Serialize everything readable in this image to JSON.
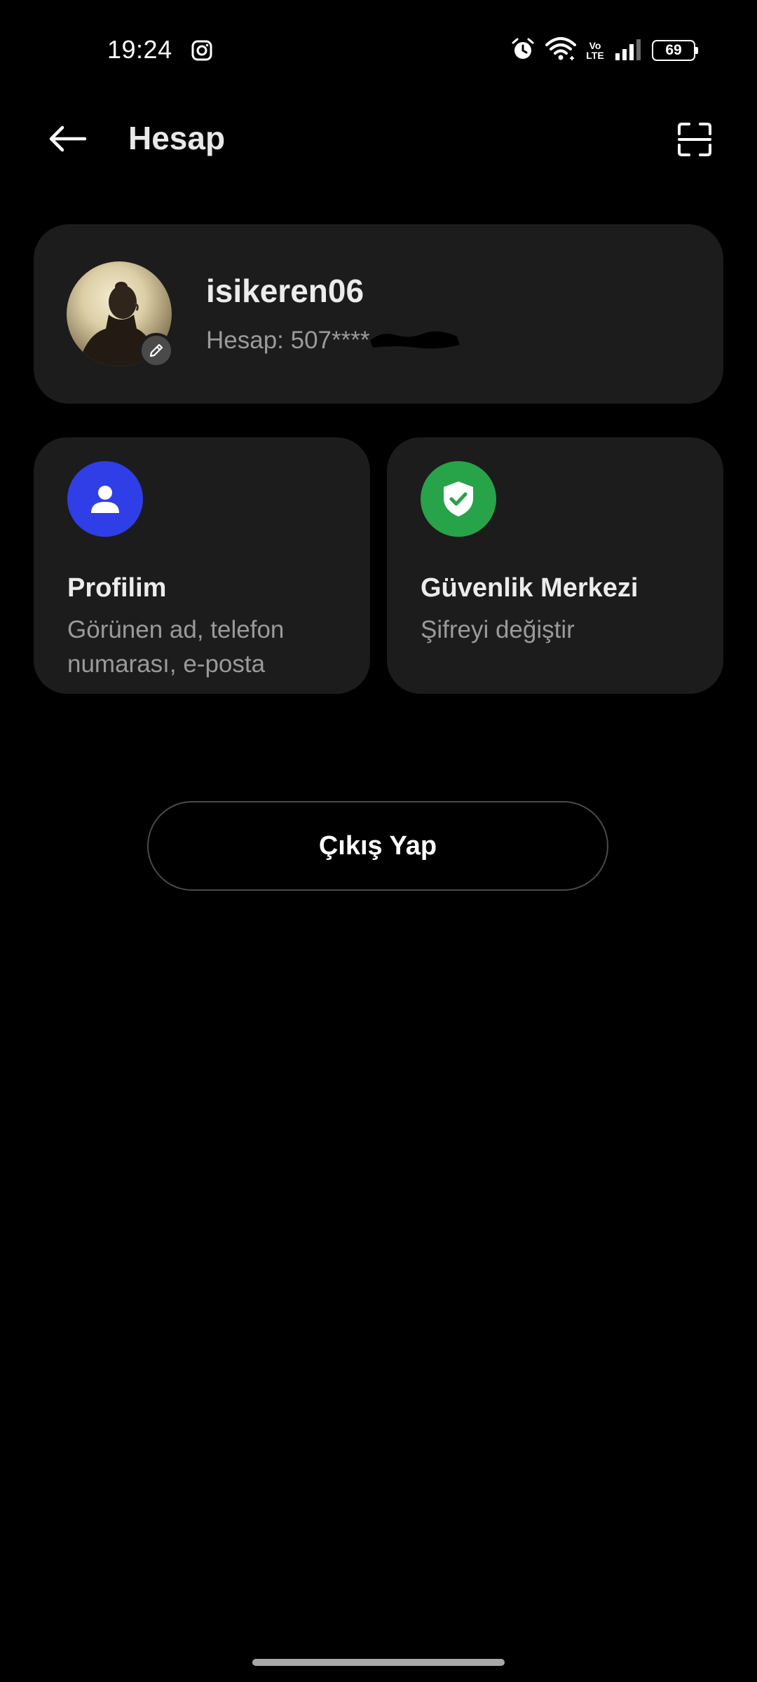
{
  "status_bar": {
    "time": "19:24",
    "battery": "69",
    "volte_top": "Vo",
    "volte_bottom": "LTE",
    "icons": [
      "instagram-icon",
      "alarm-icon",
      "wifi-icon",
      "volte-icon",
      "signal-icon",
      "battery-icon"
    ]
  },
  "header": {
    "title": "Hesap",
    "back_icon": "back-arrow-icon",
    "scan_icon": "scan-icon"
  },
  "account": {
    "username": "isikeren06",
    "account_label": "Hesap: 507****",
    "avatar_icon": "avatar",
    "edit_icon": "pencil-icon"
  },
  "tiles": [
    {
      "title": "Profilim",
      "subtitle": "Görünen ad, telefon numarası, e-posta",
      "icon": "person-icon",
      "color": "#2f3ee6"
    },
    {
      "title": "Güvenlik Merkezi",
      "subtitle": "Şifreyi değiştir",
      "icon": "shield-check-icon",
      "color": "#27a34a"
    }
  ],
  "logout": {
    "label": "Çıkış Yap"
  }
}
